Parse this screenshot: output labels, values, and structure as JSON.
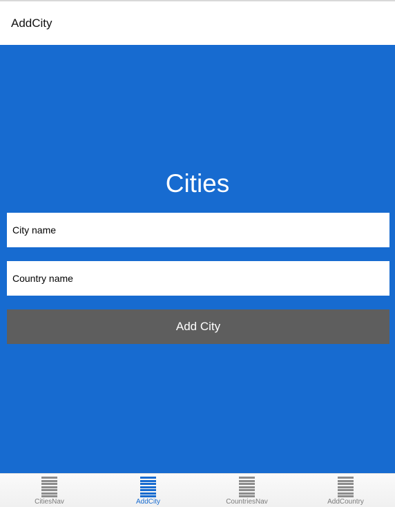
{
  "header": {
    "title": "AddCity"
  },
  "main": {
    "title": "Cities",
    "city_field": {
      "placeholder": "City name",
      "value": ""
    },
    "country_field": {
      "placeholder": "Country name",
      "value": ""
    },
    "add_button_label": "Add City"
  },
  "tabs": [
    {
      "label": "CitiesNav",
      "icon": "list-icon",
      "active": false
    },
    {
      "label": "AddCity",
      "icon": "list-icon",
      "active": true
    },
    {
      "label": "CountriesNav",
      "icon": "list-icon",
      "active": false
    },
    {
      "label": "AddCountry",
      "icon": "list-icon",
      "active": false
    }
  ],
  "colors": {
    "primary": "#176bd0",
    "button": "#5e5e5e",
    "tab_inactive": "#8c8c8c"
  }
}
